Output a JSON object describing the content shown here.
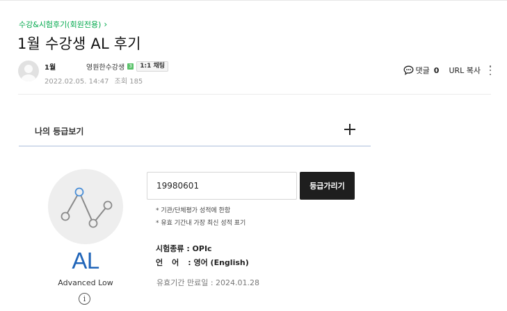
{
  "breadcrumb": {
    "label": "수강&시험후기(회원전용)",
    "chevron": "›"
  },
  "post": {
    "title": "1월 수강생 AL 후기"
  },
  "author": {
    "name": "1월",
    "tag": "영원한수강생",
    "level_badge": "3",
    "chat_label": "1:1 채팅",
    "date": "2022.02.05. 14:47",
    "views_label": "조회 185"
  },
  "tools": {
    "comment_label": "댓글",
    "comment_count": "0",
    "url_copy_label": "URL 복사"
  },
  "grade_panel": {
    "title": "나의 등급보기"
  },
  "level": {
    "code": "AL",
    "name": "Advanced Low",
    "info_symbol": "i"
  },
  "form": {
    "birth_value": "19980601",
    "button_label": "등급가리기"
  },
  "notes": [
    "* 기관/단체평가 성적에 한함",
    "* 유효 기간내 가장 최신 성적 표기"
  ],
  "exam": {
    "type_key": "시험종류",
    "type_value": "OPIc",
    "lang_key": "언어",
    "lang_value": "영어 (English)",
    "expiry_label": "유효기간 만료일 : 2024.01.28"
  },
  "colors": {
    "breadcrumb": "#03a94d",
    "level_code": "#2065b9",
    "graph_highlight": "#4a8fd8",
    "button_bg": "#1e1e1e"
  }
}
